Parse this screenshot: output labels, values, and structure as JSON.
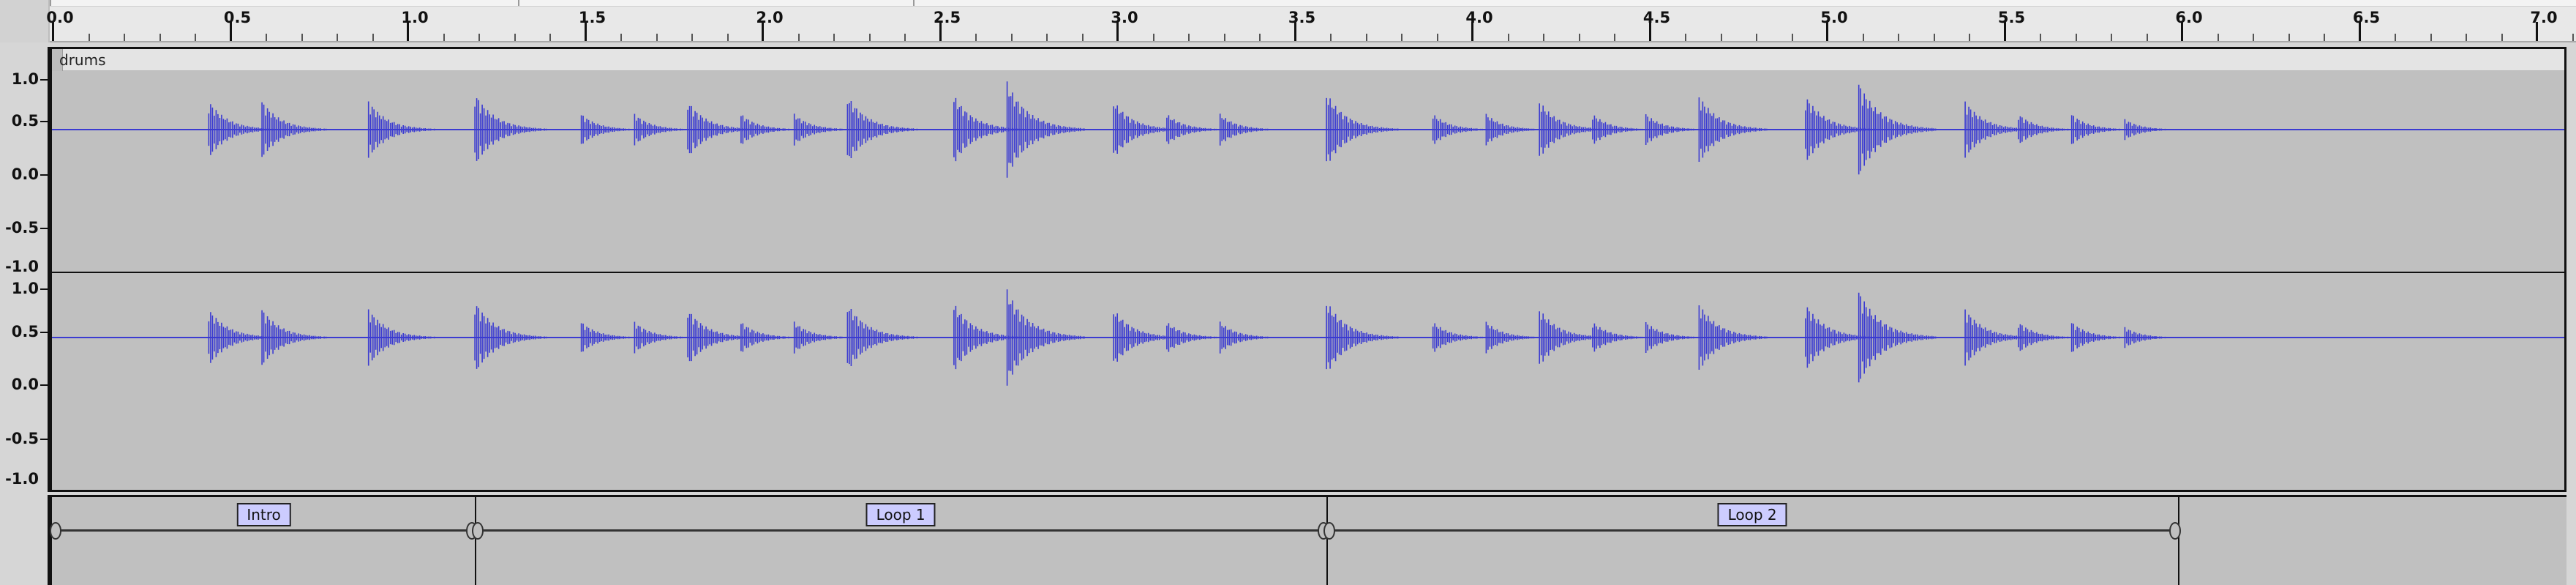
{
  "ruler": {
    "ticks": [
      "0.0",
      "0.5",
      "1.0",
      "1.5",
      "2.0",
      "2.5",
      "3.0",
      "3.5",
      "4.0",
      "4.5",
      "5.0",
      "5.5",
      "6.0",
      "6.5",
      "7.0"
    ]
  },
  "track": {
    "clip_name": "drums",
    "channel_left": {
      "scale": [
        "1.0",
        "0.5",
        "0.0",
        "-0.5",
        "-1.0"
      ]
    },
    "channel_right": {
      "scale": [
        "1.0",
        "0.5",
        "0.0",
        "-0.5",
        "-1.0"
      ]
    },
    "waveform_color": "#3b3bd1",
    "background_color": "#c0c0c0",
    "hits": [
      {
        "t": 0.44,
        "amp": 0.55
      },
      {
        "t": 0.59,
        "amp": 0.55
      },
      {
        "t": 0.89,
        "amp": 0.55
      },
      {
        "t": 1.19,
        "amp": 0.7
      },
      {
        "t": 1.49,
        "amp": 0.3
      },
      {
        "t": 1.64,
        "amp": 0.3
      },
      {
        "t": 1.79,
        "amp": 0.55
      },
      {
        "t": 1.94,
        "amp": 0.3
      },
      {
        "t": 2.09,
        "amp": 0.3
      },
      {
        "t": 2.24,
        "amp": 0.65
      },
      {
        "t": 2.54,
        "amp": 0.65
      },
      {
        "t": 2.69,
        "amp": 0.9
      },
      {
        "t": 2.99,
        "amp": 0.55
      },
      {
        "t": 3.14,
        "amp": 0.3
      },
      {
        "t": 3.29,
        "amp": 0.3
      },
      {
        "t": 3.59,
        "amp": 0.7
      },
      {
        "t": 3.89,
        "amp": 0.3
      },
      {
        "t": 4.04,
        "amp": 0.3
      },
      {
        "t": 4.19,
        "amp": 0.55
      },
      {
        "t": 4.34,
        "amp": 0.3
      },
      {
        "t": 4.49,
        "amp": 0.3
      },
      {
        "t": 4.64,
        "amp": 0.65
      },
      {
        "t": 4.94,
        "amp": 0.65
      },
      {
        "t": 5.09,
        "amp": 0.9
      },
      {
        "t": 5.39,
        "amp": 0.55
      },
      {
        "t": 5.54,
        "amp": 0.3
      },
      {
        "t": 5.69,
        "amp": 0.3
      },
      {
        "t": 5.84,
        "amp": 0.2
      }
    ]
  },
  "labels": [
    {
      "text": "Intro",
      "start": 0.0,
      "end": 1.19
    },
    {
      "text": "Loop 1",
      "start": 1.19,
      "end": 3.59
    },
    {
      "text": "Loop 2",
      "start": 3.59,
      "end": 5.99
    }
  ]
}
